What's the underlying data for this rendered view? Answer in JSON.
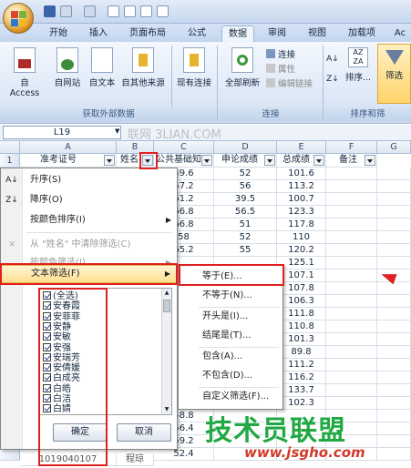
{
  "tabs": [
    "开始",
    "插入",
    "页面布局",
    "公式",
    "数据",
    "审阅",
    "视图",
    "加载项",
    "Ac"
  ],
  "active_tab": "数据",
  "ribbon": {
    "get_data": [
      "自 Access",
      "自网站",
      "自文本",
      "自其他来源"
    ],
    "existing": "现有连接",
    "refresh": "全部刷新",
    "connections": [
      "连接",
      "属性",
      "编辑链接"
    ],
    "sort": "排序...",
    "filter": "筛选",
    "groups": [
      "获取外部数据",
      "连接",
      "排序和筛"
    ]
  },
  "namebox": "L19",
  "watermark_top": "联网 3LIAN.COM",
  "columns": [
    "A",
    "B",
    "C",
    "D",
    "E",
    "F",
    "G"
  ],
  "headers": [
    "准考证号",
    "姓名",
    "公共基础知",
    "申论成绩",
    "总成绩",
    "备注"
  ],
  "rows": [
    [
      "49.6",
      "52",
      "101.6"
    ],
    [
      "57.2",
      "56",
      "113.2"
    ],
    [
      "61.2",
      "39.5",
      "100.7"
    ],
    [
      "66.8",
      "56.5",
      "123.3"
    ],
    [
      "66.8",
      "51",
      "117.8"
    ],
    [
      "58",
      "52",
      "110"
    ],
    [
      "65.2",
      "55",
      "120.2"
    ],
    [
      "",
      "",
      "125.1"
    ],
    [
      "",
      "",
      "107.1"
    ],
    [
      "",
      "",
      "107.8"
    ],
    [
      "",
      "",
      "106.3"
    ],
    [
      "",
      "",
      "111.8"
    ],
    [
      "",
      "",
      "110.8"
    ],
    [
      "",
      "",
      "101.3"
    ],
    [
      "",
      "",
      "89.8"
    ],
    [
      "",
      "",
      "111.2"
    ],
    [
      "",
      "",
      "116.2"
    ],
    [
      "",
      "",
      "133.7"
    ],
    [
      "",
      "",
      "102.3"
    ],
    [
      "48.8",
      "",
      ""
    ],
    [
      "56.4",
      "",
      ""
    ],
    [
      "59.2",
      "",
      ""
    ],
    [
      "52.4",
      "",
      ""
    ]
  ],
  "row_numbers": [
    "1"
  ],
  "dropdown": {
    "sort_asc": "升序(S)",
    "sort_desc": "降序(O)",
    "sort_color": "按颜色排序(I)",
    "clear_filter": "从 \"姓名\" 中清除筛选(C)",
    "filter_color": "按颜色筛选(I)",
    "text_filter": "文本筛选(F)",
    "list": [
      "(全选)",
      "安春霞",
      "安菲菲",
      "安静",
      "安敏",
      "安强",
      "安瑞芳",
      "安倩媛",
      "白成亮",
      "白皓",
      "白洁",
      "白婧"
    ],
    "ok": "确定",
    "cancel": "取消"
  },
  "submenu": [
    "等于(E)...",
    "不等于(N)...",
    "开头是(I)...",
    "结尾是(T)...",
    "包含(A)...",
    "不包含(D)...",
    "自定义筛选(F)..."
  ],
  "bottom_row": [
    "1019040107",
    "程琼"
  ],
  "watermark_big": "技术员联盟",
  "watermark_url": "www.jsgho.com"
}
